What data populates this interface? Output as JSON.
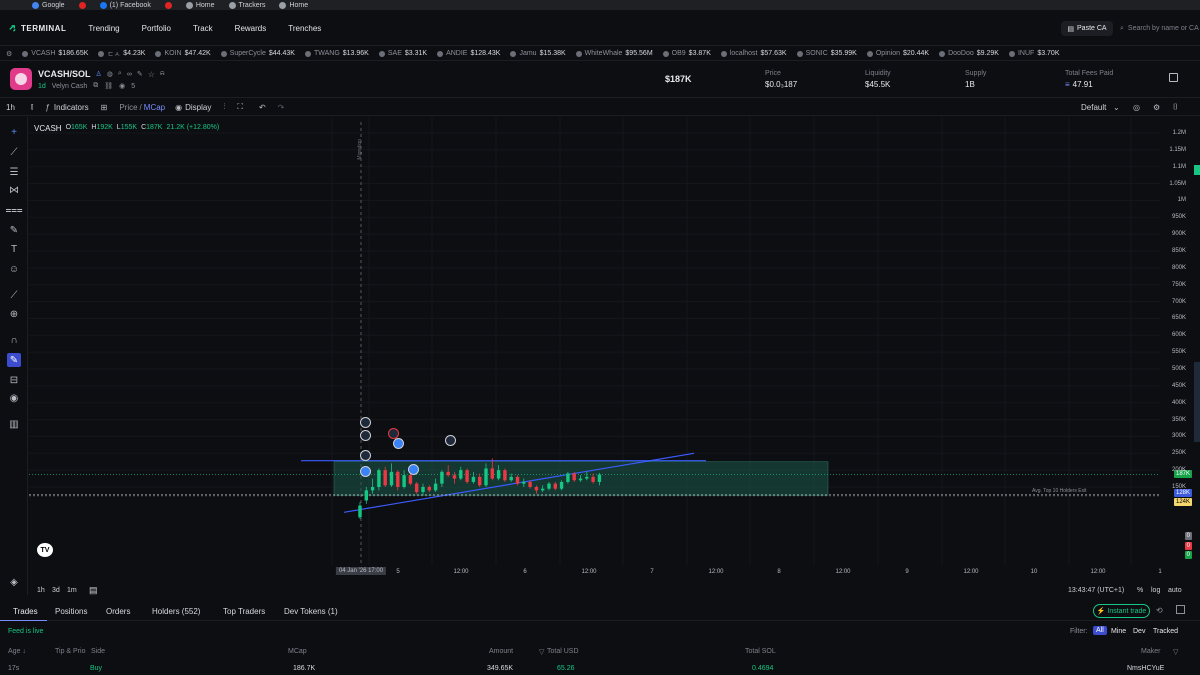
{
  "bookmarks": [
    {
      "label": "Google",
      "color": "#4285f4"
    },
    {
      "label": "",
      "color": "#e02424"
    },
    {
      "label": "(1) Facebook",
      "color": "#1877f2"
    },
    {
      "label": "",
      "color": "#e02424"
    },
    {
      "label": "Home",
      "color": "#9aa0a6"
    },
    {
      "label": "Trackers",
      "color": "#9aa0a6"
    },
    {
      "label": "Home",
      "color": "#9aa0a6"
    }
  ],
  "nav": {
    "brand": "TERMINAL",
    "items": [
      "Trending",
      "Portfolio",
      "Track",
      "Rewards",
      "Trenches"
    ],
    "paste_ca": "Paste CA",
    "search_placeholder": "Search by name or CA"
  },
  "ticker": [
    {
      "name": "VCASH",
      "value": "$186.65K"
    },
    {
      "name": "ㄷㅅ",
      "value": "$4.23K"
    },
    {
      "name": "KOIN",
      "value": "$47.42K"
    },
    {
      "name": "SuperCycle",
      "value": "$44.43K"
    },
    {
      "name": "TWANG",
      "value": "$13.96K"
    },
    {
      "name": "SAE",
      "value": "$3.31K"
    },
    {
      "name": "ANDIE",
      "value": "$128.43K"
    },
    {
      "name": "Jamu",
      "value": "$15.38K"
    },
    {
      "name": "WhiteWhale",
      "value": "$95.56M"
    },
    {
      "name": "OB9",
      "value": "$3.87K"
    },
    {
      "name": "localhost",
      "value": "$57.63K"
    },
    {
      "name": "SONIC",
      "value": "$35.99K"
    },
    {
      "name": "Opinion",
      "value": "$20.44K"
    },
    {
      "name": "DooDoo",
      "value": "$9.29K"
    },
    {
      "name": "INUF",
      "value": "$3.70K"
    }
  ],
  "token": {
    "pair": "VCASH/SOL",
    "age": "1d",
    "name": "Velyn Cash",
    "watchers": "5",
    "mcap": "$187K",
    "price_label": "Price",
    "price_value": "$0.0₃187",
    "liquidity_label": "Liquidity",
    "liquidity_value": "$45.5K",
    "supply_label": "Supply",
    "supply_value": "1B",
    "fees_label": "Total Fees Paid",
    "fees_value": "47.91"
  },
  "toolbar": {
    "interval": "1h",
    "indicators": "Indicators",
    "price": "Price",
    "mcap": "MCap",
    "display": "Display",
    "default_layout": "Default"
  },
  "ohlc": {
    "symbol": "VCASH",
    "o_label": "O",
    "o_value": "165K",
    "h_label": "H",
    "h_value": "192K",
    "l_label": "L",
    "l_value": "155K",
    "c_label": "C",
    "c_value": "187K",
    "change": "21.2K (+12.80%)"
  },
  "chart_data": {
    "type": "candlestick",
    "y_ticks": [
      "1.2M",
      "1.15M",
      "1.1M",
      "1.05M",
      "1M",
      "950K",
      "900K",
      "850K",
      "800K",
      "750K",
      "700K",
      "650K",
      "600K",
      "550K",
      "500K",
      "450K",
      "400K",
      "350K",
      "300K",
      "250K",
      "200K",
      "150K"
    ],
    "x_ticks": [
      "04 Jan '26  17:00",
      "5",
      "12:00",
      "6",
      "12:00",
      "7",
      "12:00",
      "8",
      "12:00",
      "9",
      "12:00",
      "10",
      "12:00",
      "1"
    ],
    "price_badges": [
      {
        "label": "187K",
        "color": "#16a34a"
      },
      {
        "label": "128K",
        "color": "#3b5bdb"
      },
      {
        "label": "124K",
        "color": "#f5d76e"
      }
    ],
    "volume_badges": [
      "0",
      "0",
      "0"
    ],
    "annotation": "Migration",
    "avg_label": "Avg. Top 10 Holders Exit",
    "candles": [
      {
        "o": 60,
        "c": 95,
        "h": 105,
        "l": 55
      },
      {
        "o": 110,
        "c": 140,
        "h": 150,
        "l": 100
      },
      {
        "o": 140,
        "c": 150,
        "h": 175,
        "l": 130
      },
      {
        "o": 150,
        "c": 200,
        "h": 205,
        "l": 140
      },
      {
        "o": 200,
        "c": 155,
        "h": 210,
        "l": 150
      },
      {
        "o": 155,
        "c": 195,
        "h": 220,
        "l": 150
      },
      {
        "o": 195,
        "c": 150,
        "h": 200,
        "l": 140
      },
      {
        "o": 150,
        "c": 185,
        "h": 200,
        "l": 145
      },
      {
        "o": 185,
        "c": 160,
        "h": 195,
        "l": 155
      },
      {
        "o": 160,
        "c": 135,
        "h": 165,
        "l": 130
      },
      {
        "o": 135,
        "c": 150,
        "h": 160,
        "l": 125
      },
      {
        "o": 150,
        "c": 140,
        "h": 155,
        "l": 135
      },
      {
        "o": 140,
        "c": 160,
        "h": 175,
        "l": 135
      },
      {
        "o": 160,
        "c": 195,
        "h": 200,
        "l": 150
      },
      {
        "o": 195,
        "c": 185,
        "h": 215,
        "l": 180
      },
      {
        "o": 185,
        "c": 175,
        "h": 195,
        "l": 160
      },
      {
        "o": 175,
        "c": 200,
        "h": 210,
        "l": 170
      },
      {
        "o": 200,
        "c": 165,
        "h": 205,
        "l": 160
      },
      {
        "o": 165,
        "c": 180,
        "h": 195,
        "l": 160
      },
      {
        "o": 180,
        "c": 155,
        "h": 190,
        "l": 150
      },
      {
        "o": 155,
        "c": 205,
        "h": 220,
        "l": 150
      },
      {
        "o": 205,
        "c": 175,
        "h": 235,
        "l": 170
      },
      {
        "o": 175,
        "c": 200,
        "h": 215,
        "l": 170
      },
      {
        "o": 200,
        "c": 170,
        "h": 205,
        "l": 165
      },
      {
        "o": 170,
        "c": 180,
        "h": 190,
        "l": 165
      },
      {
        "o": 180,
        "c": 160,
        "h": 185,
        "l": 155
      },
      {
        "o": 160,
        "c": 165,
        "h": 175,
        "l": 150
      },
      {
        "o": 165,
        "c": 150,
        "h": 170,
        "l": 145
      },
      {
        "o": 150,
        "c": 140,
        "h": 155,
        "l": 130
      },
      {
        "o": 140,
        "c": 145,
        "h": 155,
        "l": 135
      },
      {
        "o": 145,
        "c": 160,
        "h": 165,
        "l": 140
      },
      {
        "o": 160,
        "c": 145,
        "h": 165,
        "l": 140
      },
      {
        "o": 145,
        "c": 165,
        "h": 170,
        "l": 140
      },
      {
        "o": 165,
        "c": 190,
        "h": 195,
        "l": 160
      },
      {
        "o": 190,
        "c": 170,
        "h": 195,
        "l": 165
      },
      {
        "o": 170,
        "c": 175,
        "h": 185,
        "l": 165
      },
      {
        "o": 175,
        "c": 180,
        "h": 195,
        "l": 170
      },
      {
        "o": 180,
        "c": 165,
        "h": 190,
        "l": 160
      },
      {
        "o": 165,
        "c": 187,
        "h": 192,
        "l": 155
      }
    ]
  },
  "chart_footer": {
    "ranges": [
      "1h",
      "3d",
      "1m"
    ],
    "clock": "13:43:47 (UTC+1)",
    "pct": "%",
    "log": "log",
    "auto": "auto"
  },
  "tabs": [
    "Trades",
    "Positions",
    "Orders",
    "Holders (552)",
    "Top Traders",
    "Dev Tokens (1)"
  ],
  "instant_trade": "Instant trade",
  "feed_status": "Feed is live",
  "filter": {
    "label": "Filter:",
    "options": [
      "All",
      "Mine",
      "Dev",
      "Tracked"
    ]
  },
  "table": {
    "headers": [
      "Age",
      "Tip & Prio",
      "Side",
      "MCap",
      "Amount",
      "Total USD",
      "Total SOL",
      "Maker"
    ],
    "rows": [
      {
        "age": "17s",
        "tip": "",
        "side": "Buy",
        "mcap": "186.7K",
        "amount": "349.65K",
        "usd": "65.26",
        "sol": "0.4694",
        "maker": "NmsHCYuE"
      }
    ]
  },
  "colors": {
    "up": "#16c784",
    "down": "#ea3943",
    "accent": "#7b8cff",
    "line": "#3b5bff"
  }
}
